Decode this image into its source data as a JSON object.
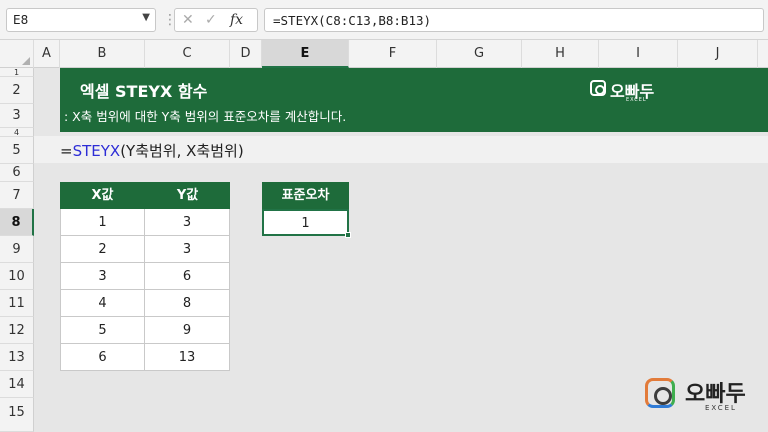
{
  "formula_bar": {
    "name_box": "E8",
    "fx": "fx",
    "formula": "=STEYX(C8:C13,B8:B13)"
  },
  "columns": [
    "A",
    "B",
    "C",
    "D",
    "E",
    "F",
    "G",
    "H",
    "I",
    "J"
  ],
  "rows": [
    "1",
    "2",
    "3",
    "4",
    "5",
    "6",
    "7",
    "8",
    "9",
    "10",
    "11",
    "12",
    "13",
    "14",
    "15"
  ],
  "selected": {
    "column": "E",
    "row": "8"
  },
  "banner": {
    "title": "엑셀 STEYX 함수",
    "subtitle": ": X축 범위에 대한 Y축 범위의 표준오차를 계산합니다.",
    "logo_text": "오빠두",
    "logo_sub": "EXCEL"
  },
  "syntax": {
    "prefix": "=",
    "function": "STEYX",
    "args": "(Y축범위, X축범위)"
  },
  "table": {
    "headers": [
      "X값",
      "Y값"
    ],
    "rows": [
      [
        "1",
        "3"
      ],
      [
        "2",
        "3"
      ],
      [
        "3",
        "6"
      ],
      [
        "4",
        "8"
      ],
      [
        "5",
        "9"
      ],
      [
        "6",
        "13"
      ]
    ]
  },
  "result": {
    "header": "표준오차",
    "value": "1"
  },
  "logo": {
    "text": "오빠두",
    "sub": "EXCEL"
  },
  "colors": {
    "excel_green": "#1e6b3a",
    "function_blue": "#2d2dd6"
  }
}
